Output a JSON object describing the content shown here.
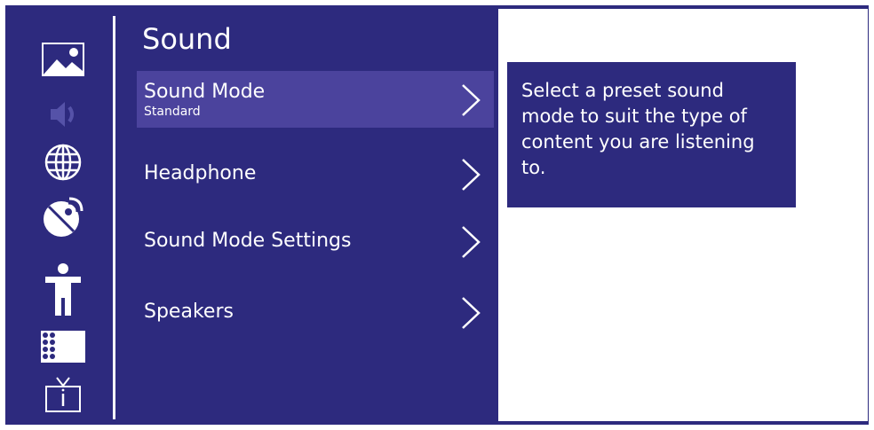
{
  "sidebar": {
    "icons": [
      {
        "name": "picture-icon",
        "active": false
      },
      {
        "name": "sound-icon",
        "active": true
      },
      {
        "name": "network-globe-icon",
        "active": false
      },
      {
        "name": "broadcast-dish-icon",
        "active": false
      },
      {
        "name": "accessibility-person-icon",
        "active": false
      },
      {
        "name": "apps-grid-icon",
        "active": false
      },
      {
        "name": "tv-info-icon",
        "active": false
      }
    ]
  },
  "menu": {
    "title": "Sound",
    "items": [
      {
        "label": "Sound Mode",
        "value": "Standard",
        "selected": true
      },
      {
        "label": "Headphone",
        "selected": false
      },
      {
        "label": "Sound Mode Settings",
        "selected": false
      },
      {
        "label": "Speakers",
        "selected": false
      }
    ]
  },
  "help": {
    "text": "Select a preset sound mode to suit the type of content you are listening to."
  },
  "colors": {
    "background": "#2d2a7e",
    "selected_row": "#4b439d",
    "text": "#ffffff",
    "inactive_icon": "#5552a8",
    "panel": "#ffffff"
  }
}
